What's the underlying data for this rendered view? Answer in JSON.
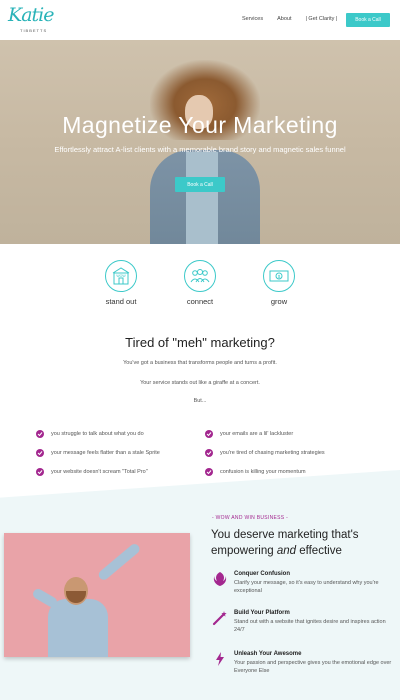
{
  "nav": {
    "logo_script": "Katie",
    "logo_sub": "TIBBETTS",
    "links": [
      "Services",
      "About",
      "| Get Clarity |"
    ],
    "cta": "Book a Call"
  },
  "hero": {
    "title": "Magnetize Your Marketing",
    "subtitle": "Effortlessly attract A-list clients with a memorable brand story and magnetic sales funnel",
    "button": "Book a Call"
  },
  "features": [
    {
      "label": "stand out",
      "icon": "storefront-icon"
    },
    {
      "label": "connect",
      "icon": "people-icon"
    },
    {
      "label": "grow",
      "icon": "money-icon"
    }
  ],
  "tired": {
    "title": "Tired of \"meh\" marketing?",
    "lines": [
      "You've got a business that transforms people and turns a profit.",
      "Your service stands out like a giraffe at a concert.",
      "But..."
    ]
  },
  "checklist": [
    "you struggle to talk about what you do",
    "your emails are a lil' lackluster",
    "your message feels flatter than a stale Sprite",
    "you're tired of chasing marketing strategies",
    "your website doesn't scream \"Total Pro\"",
    "confusion is killing your momentum"
  ],
  "bottom": {
    "tag": "- WOW AND WIN BUSINESS -",
    "heading_pre": "You deserve marketing that's empowering ",
    "heading_em": "and",
    "heading_post": " effective",
    "benefits": [
      {
        "title": "Conquer Confusion",
        "desc": "Clarify your message, so it's easy to understand why you're exceptional",
        "icon": "rebel-icon"
      },
      {
        "title": "Build Your Platform",
        "desc": "Stand out with a website that ignites desire and inspires action 24/7",
        "icon": "wand-icon"
      },
      {
        "title": "Unleash Your Awesome",
        "desc": "Your passion and perspective gives you the emotional edge over Everyone Else",
        "icon": "lightning-icon"
      }
    ]
  },
  "colors": {
    "accent": "#3cc9c9",
    "check": "#a3278f",
    "tag": "#a3278f"
  }
}
